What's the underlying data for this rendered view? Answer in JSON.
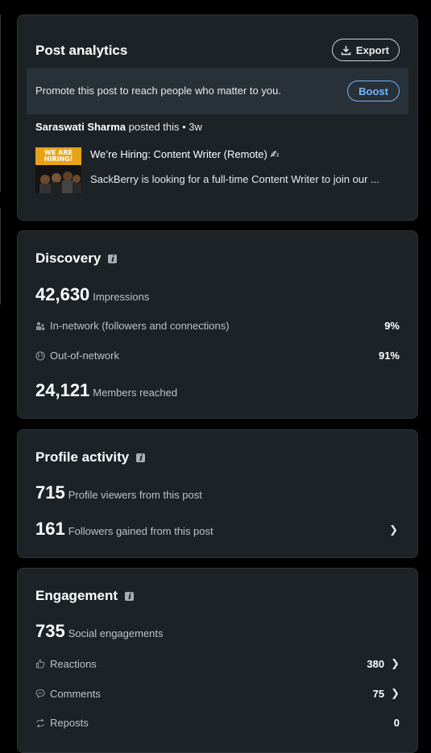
{
  "post_analytics": {
    "title": "Post analytics",
    "export_label": "Export",
    "promo_text": "Promote this post to reach people who matter to you.",
    "boost_label": "Boost",
    "author": "Saraswati Sharma",
    "posted_suffix": "posted this • 3w",
    "post_title": "We’re Hiring: Content Writer (Remote) ✍",
    "post_excerpt": "SackBerry is looking for a full-time Content Writer to join our ...",
    "thumbnail_text": "WE ARE HIRING!"
  },
  "discovery": {
    "title": "Discovery",
    "impressions_value": "42,630",
    "impressions_label": "Impressions",
    "in_network_label": "In-network (followers and connections)",
    "in_network_value": "9%",
    "out_network_label": "Out-of-network",
    "out_network_value": "91%",
    "members_value": "24,121",
    "members_label": "Members reached"
  },
  "profile_activity": {
    "title": "Profile activity",
    "viewers_value": "715",
    "viewers_label": "Profile viewers from this post",
    "followers_value": "161",
    "followers_label": "Followers gained from this post",
    "chevron": "❯"
  },
  "engagement": {
    "title": "Engagement",
    "social_value": "735",
    "social_label": "Social engagements",
    "reactions_label": "Reactions",
    "reactions_value": "380",
    "comments_label": "Comments",
    "comments_value": "75",
    "reposts_label": "Reposts",
    "reposts_value": "0",
    "chevron": "❯"
  },
  "colors": {
    "page_bg": "#000000",
    "card_bg": "#1d2226",
    "band_bg": "#293138",
    "accent_blue": "#71b7fb",
    "text_primary": "#ffffff",
    "text_secondary": "#bfc3c6"
  },
  "icons": {
    "export": "download-icon",
    "in_network": "people-icon",
    "out_network": "globe-icon",
    "reactions": "thumbs-up-icon",
    "comments": "comment-icon",
    "reposts": "repost-icon",
    "info": "info-icon"
  }
}
